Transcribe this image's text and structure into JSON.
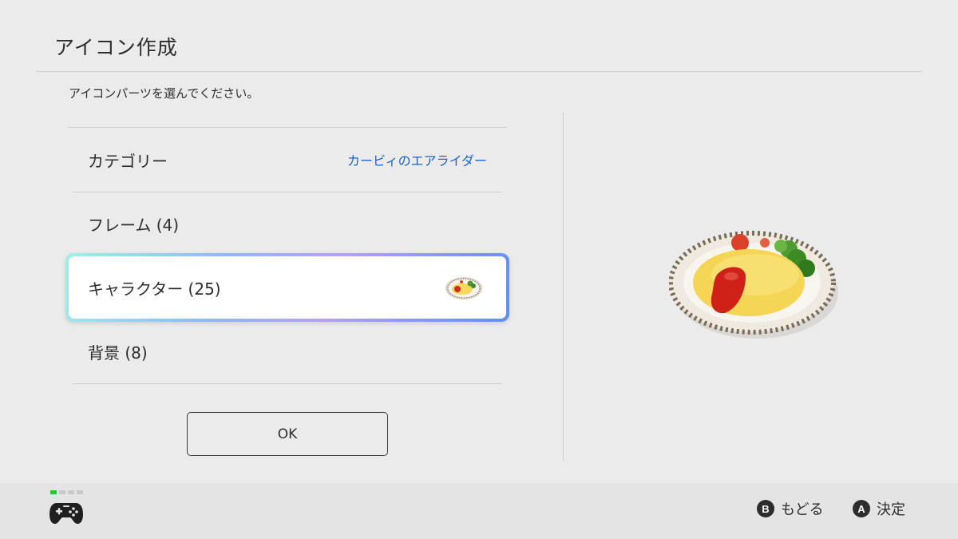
{
  "header": {
    "title": "アイコン作成"
  },
  "instruction": "アイコンパーツを選んでください。",
  "menu": {
    "category": {
      "label": "カテゴリー",
      "value": "カービィのエアライダー"
    },
    "items": [
      {
        "label": "フレーム (4)"
      },
      {
        "label": "キャラクター (25)",
        "selected": true,
        "thumbnail": "omelette-rice-icon"
      },
      {
        "label": "背景 (8)"
      }
    ]
  },
  "ok_button": {
    "label": "OK"
  },
  "preview": {
    "image": "omelette-rice-on-plate"
  },
  "footer": {
    "controller_icon": "gamepad-icon",
    "hints": [
      {
        "button": "B",
        "label": "もどる"
      },
      {
        "button": "A",
        "label": "決定"
      }
    ]
  },
  "colors": {
    "accent_link": "#1a63c8",
    "player_indicator": "#2fc32f"
  }
}
